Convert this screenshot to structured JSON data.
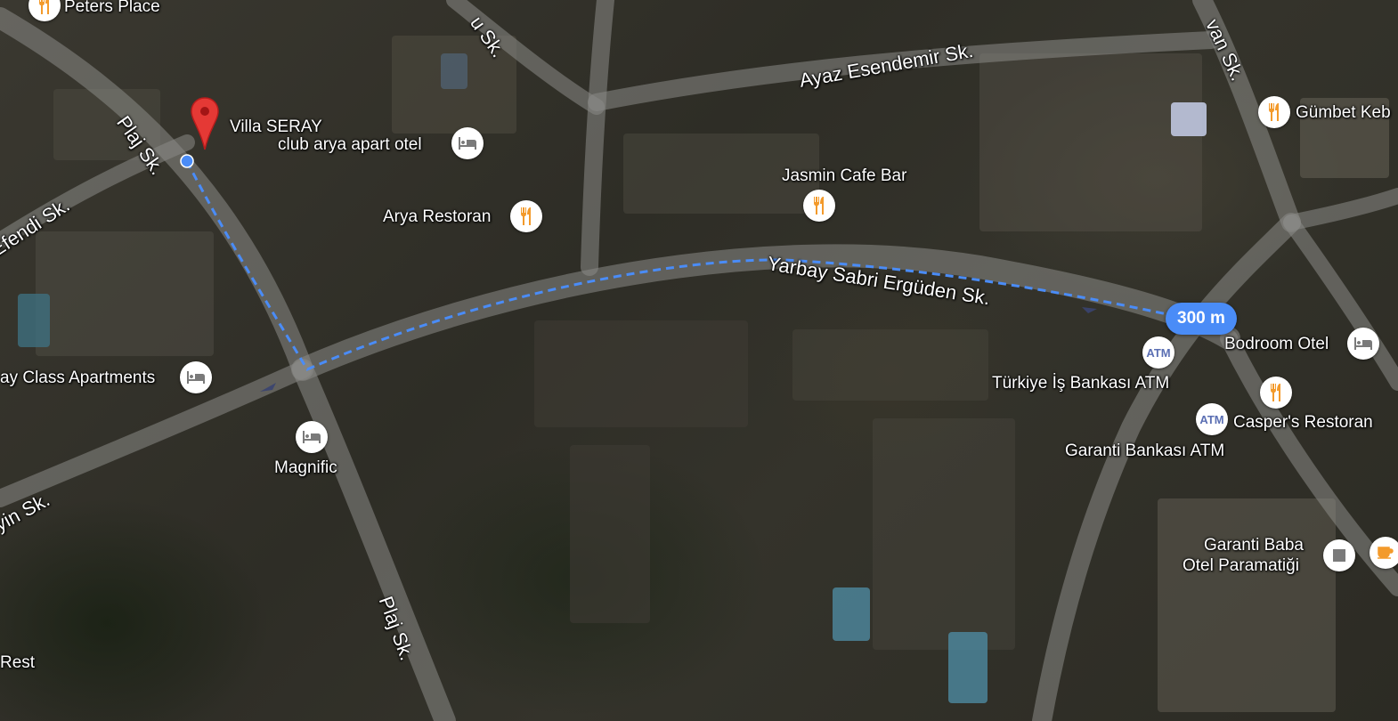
{
  "map": {
    "view": "satellite",
    "route_color": "#4a8cf7",
    "road_color": "#8a8a86"
  },
  "streets": {
    "plaj_top": "Plaj Sk.",
    "plaj_bottom": "Plaj Sk.",
    "efendi": "Efendi Sk.",
    "ayaz": "Ayaz Esendemir Sk.",
    "yarbay": "Yarbay Sabri Ergüden Sk.",
    "yin": "yin Sk.",
    "top_partial": "u Sk.",
    "right_partial": "van Sk."
  },
  "places": {
    "peters": "Peters Place",
    "villa": "Villa SERAY",
    "club_arya": "club arya apart otel",
    "arya_restoran": "Arya Restoran",
    "jasmin": "Jasmin Cafe Bar",
    "gumbet": "Gümbet Keb",
    "class_apartments": "ay Class Apartments",
    "magnific": "Magnific",
    "turkiye_atm": "Türkiye İş Bankası ATM",
    "garanti_atm": "Garanti Bankası ATM",
    "bodroom": "Bodroom Otel",
    "caspers": "Casper's Restoran",
    "garanti_baba_1": "Garanti Baba",
    "garanti_baba_2": "Otel Paramatiği",
    "rest": "Rest"
  },
  "route": {
    "distance_label": "300 m"
  },
  "icons": {
    "restaurant": "fork-knife-icon",
    "hotel": "bed-icon",
    "atm": "atm-icon",
    "atm_text": "ATM",
    "cafe": "cup-icon",
    "shop": "square-icon",
    "marker": "red-pin-icon"
  }
}
